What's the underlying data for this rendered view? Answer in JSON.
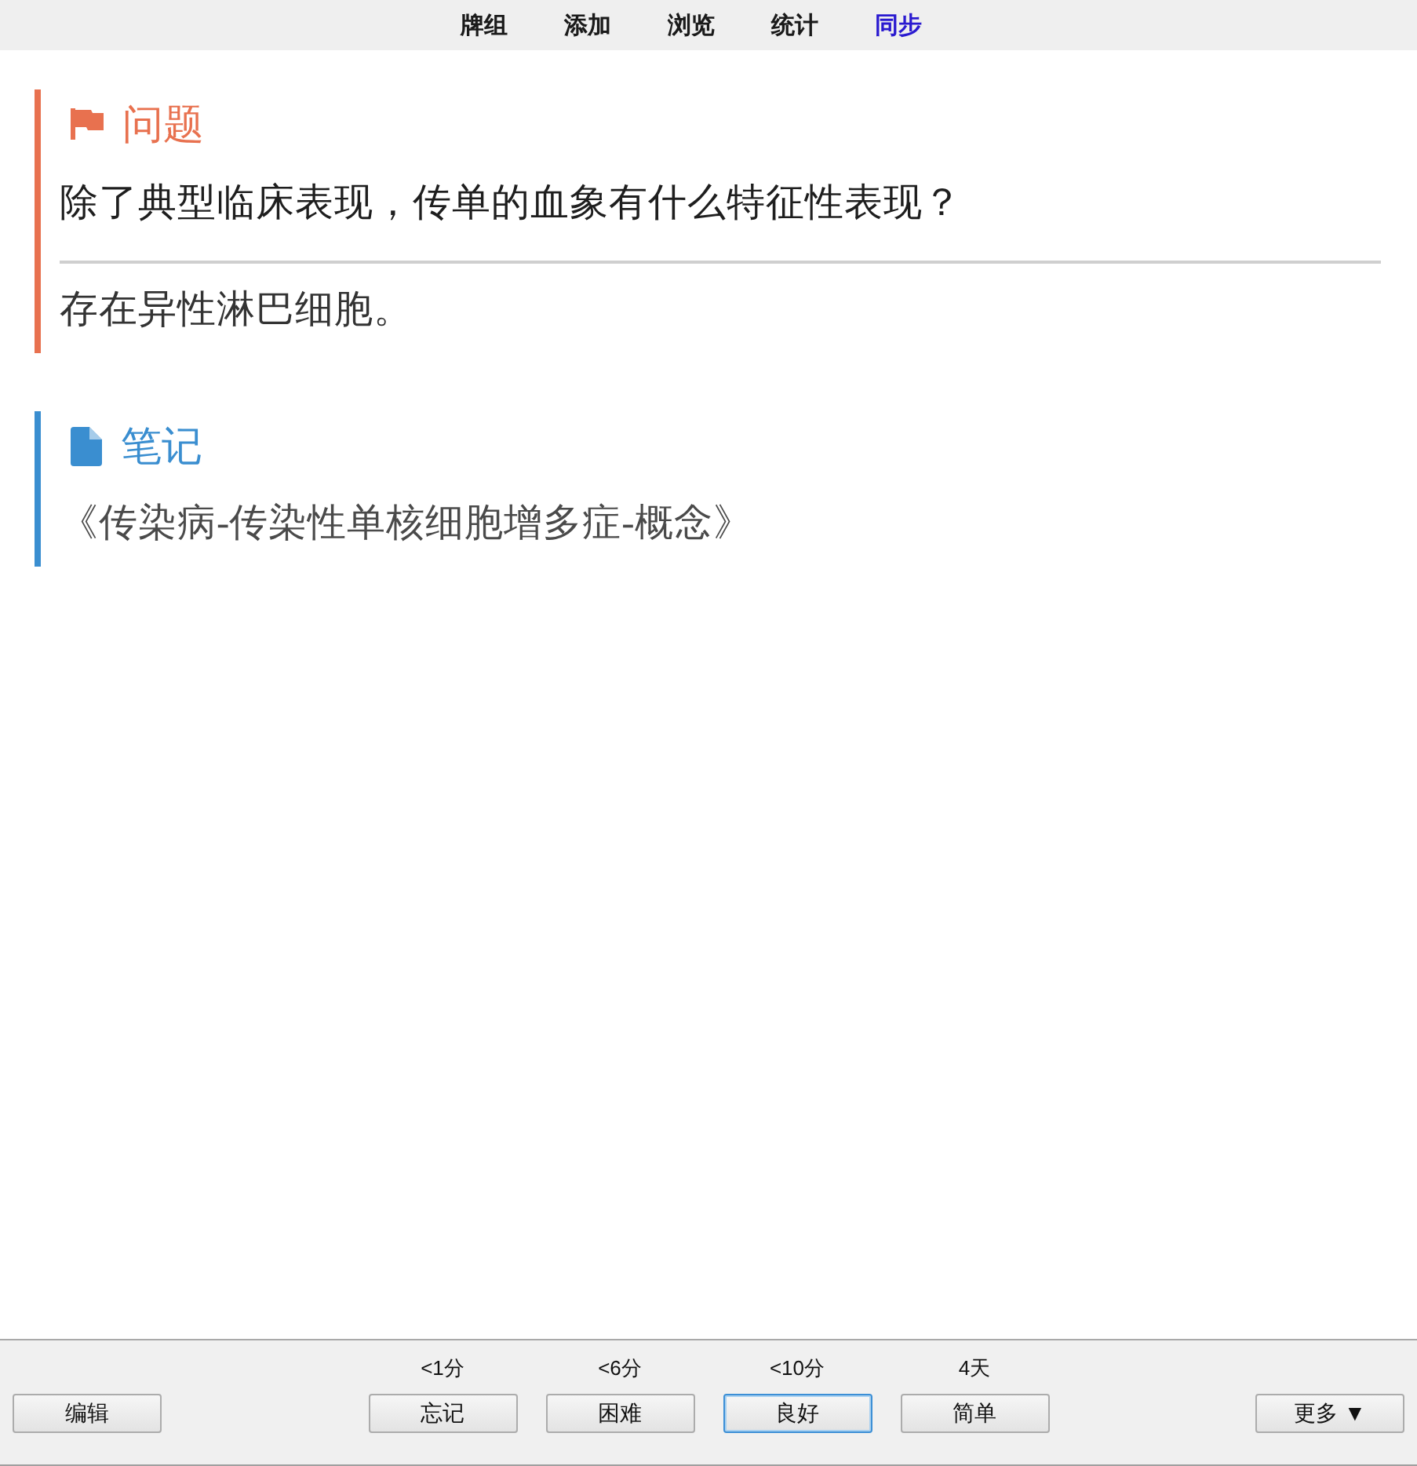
{
  "nav": [
    {
      "label": "牌组",
      "highlighted": false
    },
    {
      "label": "添加",
      "highlighted": false
    },
    {
      "label": "浏览",
      "highlighted": false
    },
    {
      "label": "统计",
      "highlighted": false
    },
    {
      "label": "同步",
      "highlighted": true
    }
  ],
  "sections": [
    {
      "kind": "question",
      "title": "问题",
      "color": "#e8714f",
      "question": "除了典型临床表现，传单的血象有什么特征性表现？",
      "answer": "存在异性淋巴细胞。"
    },
    {
      "kind": "note",
      "title": "笔记",
      "color": "#3a8ed0",
      "text": "《传染病-传染性单核细胞增多症-概念》"
    }
  ],
  "edit_button": "编辑",
  "answer_buttons": [
    {
      "interval": "<1分",
      "label": "忘记",
      "focused": false
    },
    {
      "interval": "<6分",
      "label": "困难",
      "focused": false
    },
    {
      "interval": "<10分",
      "label": "良好",
      "focused": true
    },
    {
      "interval": "4天",
      "label": "简单",
      "focused": false
    }
  ],
  "more_button": "更多 ▼"
}
